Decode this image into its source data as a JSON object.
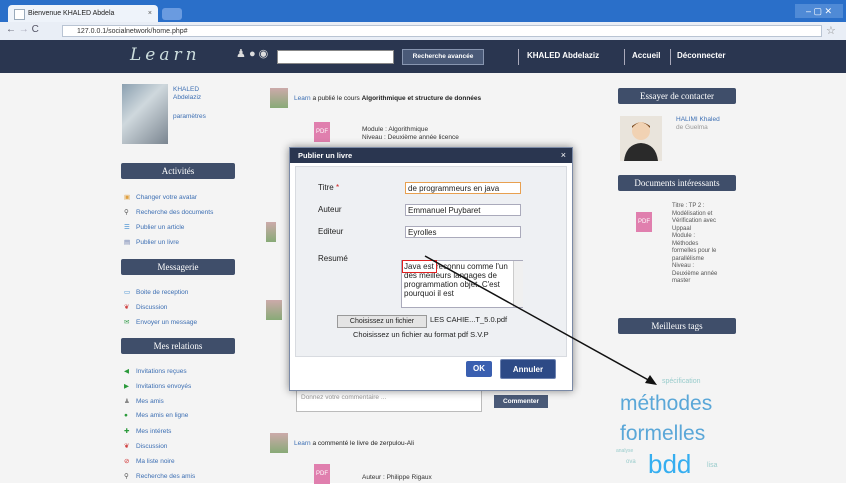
{
  "browser": {
    "tab_title": "Bienvenue KHALED Abdela",
    "url": "127.0.0.1/socialnetwork/home.php#",
    "window_controls": "– ▢ ✕"
  },
  "header": {
    "logo": "Learn",
    "advanced_search": "Recherche avancée",
    "user": "KHALED Abdelaziz",
    "home": "Accueil",
    "logout": "Déconnecter"
  },
  "profile": {
    "name_line1": "KHALED",
    "name_line2": "Abdelaziz",
    "settings": "paramètres"
  },
  "sidebar": {
    "activities_title": "Activités",
    "activities": [
      "Changer votre avatar",
      "Recherche des documents",
      "Publier un article",
      "Publier un livre"
    ],
    "messaging_title": "Messagerie",
    "messaging": [
      "Boite de reception",
      "Discussion",
      "Envoyer un message"
    ],
    "relations_title": "Mes relations",
    "relations": [
      "Invitations reçues",
      "Invitations envoyés",
      "Mes amis",
      "Mes amis en ligne",
      "Mes intérets",
      "Discussion",
      "Ma liste noire",
      "Recherche des amis"
    ]
  },
  "feed": {
    "post1_prefix": "Learn",
    "post1_text": "a publié le cours",
    "post1_title": "Algorithmique et structure de données",
    "post1_module": "Module : Algorithmique",
    "post1_level": "Niveau : Deuxième année licence",
    "post3_prefix": "Learn",
    "post3_text": "a commenté le livre de zerpulou-Ali",
    "post3_author": "Auteur : Philippe Rigaux",
    "comment_placeholder": "Donnez votre commentaire ...",
    "comment_button": "Commenter",
    "pdf_label": "PDF"
  },
  "right": {
    "contact_title": "Essayer de contacter",
    "contact_name_line1": "HALIMI Khaled",
    "contact_name_line2": "de Guelma",
    "docs_title": "Documents intéressants",
    "doc_info": [
      "Titre : TP 2 :",
      "Modélisation et",
      "Vérification avec",
      "Uppaal",
      "Module :",
      "Méthodes",
      "formelles pour le",
      "parallélisme",
      "Niveau :",
      "Deuxième année",
      "master"
    ],
    "tags_title": "Meilleurs tags",
    "tags": [
      "spécification",
      "méthodes",
      "formelles",
      "analyse",
      "bdd",
      "ova",
      "lisa"
    ]
  },
  "modal": {
    "title": "Publier un livre",
    "close": "×",
    "label_titre": "Titre",
    "required_mark": "*",
    "value_titre": "de programmeurs en java",
    "label_auteur": "Auteur",
    "value_auteur": "Emmanuel Puybaret",
    "label_editeur": "Editeur",
    "value_editeur": "Eyrolles",
    "label_resume": "Resumé",
    "value_resume": "Java est reconnu comme l'un des meilleurs langages de programmation objet. C'est pourquoi il est",
    "file_button": "Choisissez un fichier",
    "file_name": "LES CAHIE...T_5.0.pdf",
    "file_hint": "Choisissez un fichier au format pdf S.V.P",
    "ok": "OK",
    "cancel": "Annuler"
  }
}
